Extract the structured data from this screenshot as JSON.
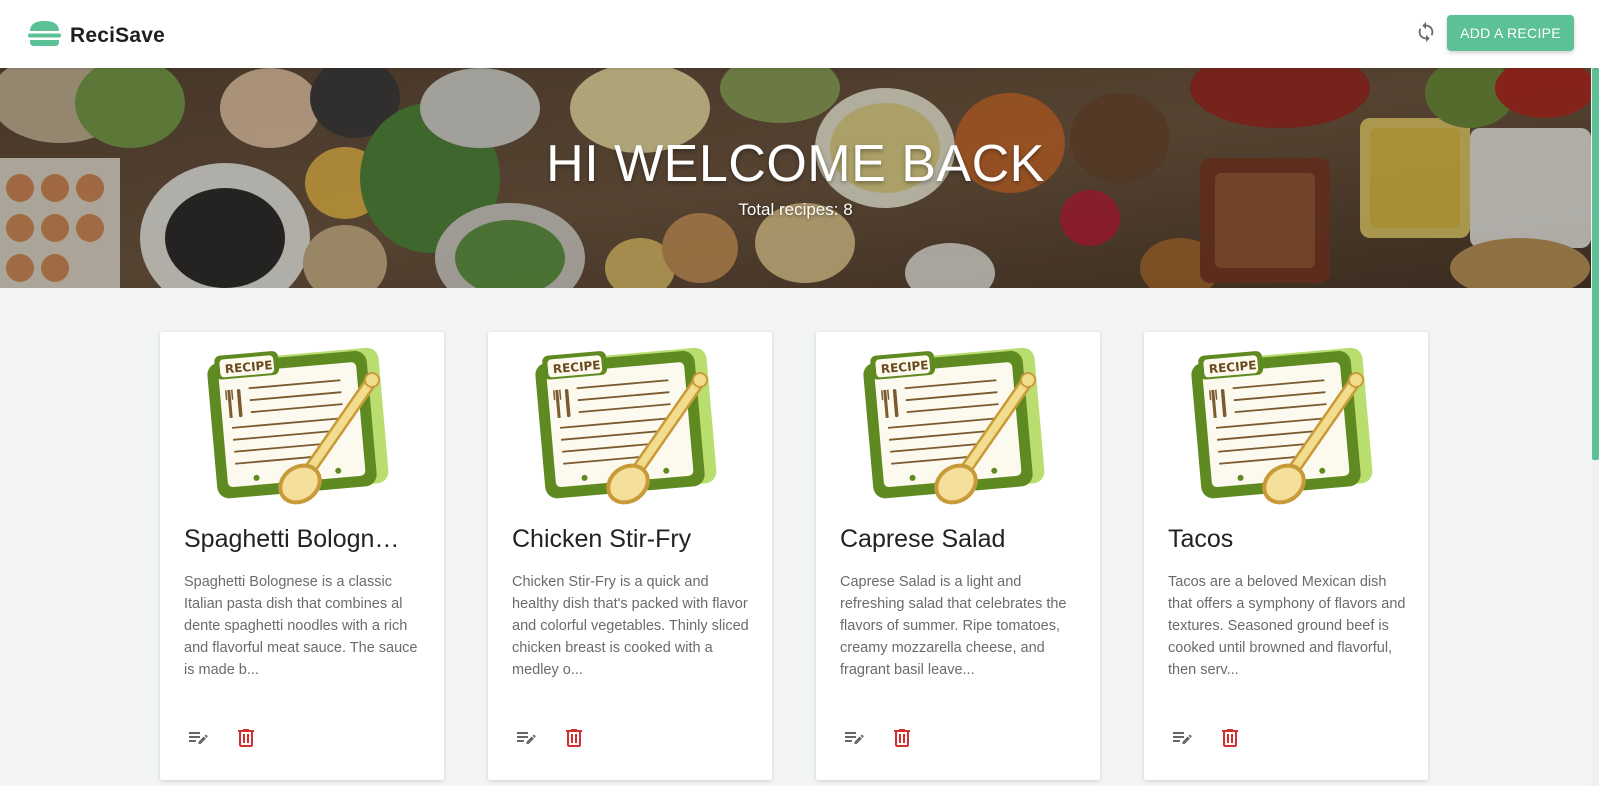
{
  "app": {
    "name": "ReciSave",
    "logo_icon": "burger-icon",
    "accent": "#5cc196"
  },
  "toolbar": {
    "refresh_icon": "refresh-icon",
    "add_label": "ADD A RECIPE"
  },
  "hero": {
    "title": "HI WELCOME BACK",
    "subtitle": "Total recipes: 8"
  },
  "recipes": [
    {
      "title": "Spaghetti Bologn…",
      "description": "Spaghetti Bolognese is a classic Italian pasta dish that combines al dente spaghetti noodles with a rich and flavorful meat sauce. The sauce is made b..."
    },
    {
      "title": "Chicken Stir-Fry",
      "description": "Chicken Stir-Fry is a quick and healthy dish that's packed with flavor and colorful vegetables. Thinly sliced chicken breast is cooked with a medley o..."
    },
    {
      "title": "Caprese Salad",
      "description": "Caprese Salad is a light and refreshing salad that celebrates the flavors of summer. Ripe tomatoes, creamy mozzarella cheese, and fragrant basil leave..."
    },
    {
      "title": "Tacos",
      "description": "Tacos are a beloved Mexican dish that offers a symphony of flavors and textures. Seasoned ground beef is cooked until browned and flavorful, then serv..."
    }
  ],
  "card_image": {
    "label": "RECIPE",
    "icon": "recipe-card-icon"
  },
  "card_actions": {
    "edit_icon": "edit-notes-icon",
    "delete_icon": "trash-icon",
    "delete_color": "#d32f2f"
  }
}
